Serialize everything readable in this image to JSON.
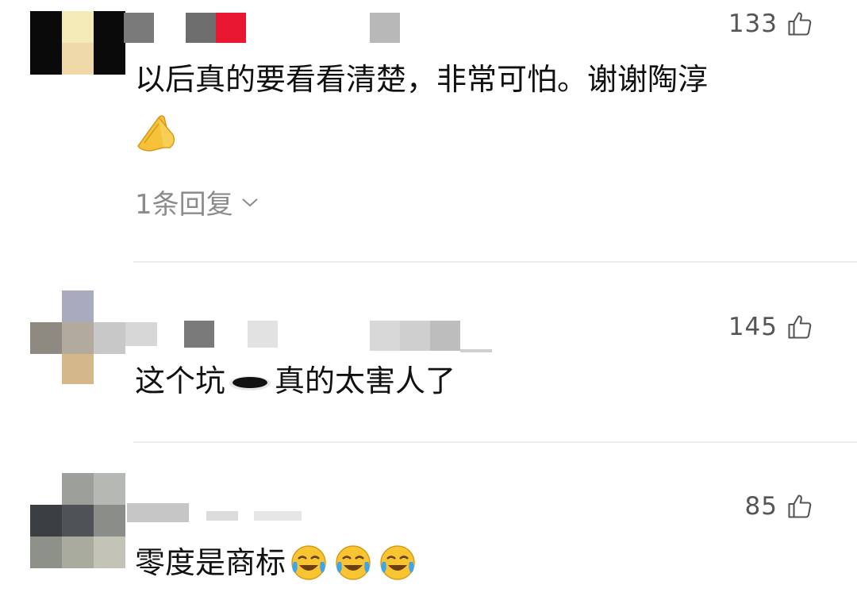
{
  "comments": [
    {
      "likes": "133",
      "text": "以后真的要看看清楚，非常可怕。谢谢陶淳",
      "emoji": "pray-icon",
      "replies_label": "1条回复"
    },
    {
      "likes": "145",
      "text_before": "这个坑",
      "text_after": "真的太害人了",
      "emoji": "hole-icon"
    },
    {
      "likes": "85",
      "text": "零度是商标",
      "emojis": [
        "tears-of-joy-icon",
        "tears-of-joy-icon",
        "tears-of-joy-icon"
      ]
    }
  ],
  "colors": {
    "like_text": "#555555",
    "reply_text": "#8b8b8b",
    "divider": "#ececec"
  }
}
